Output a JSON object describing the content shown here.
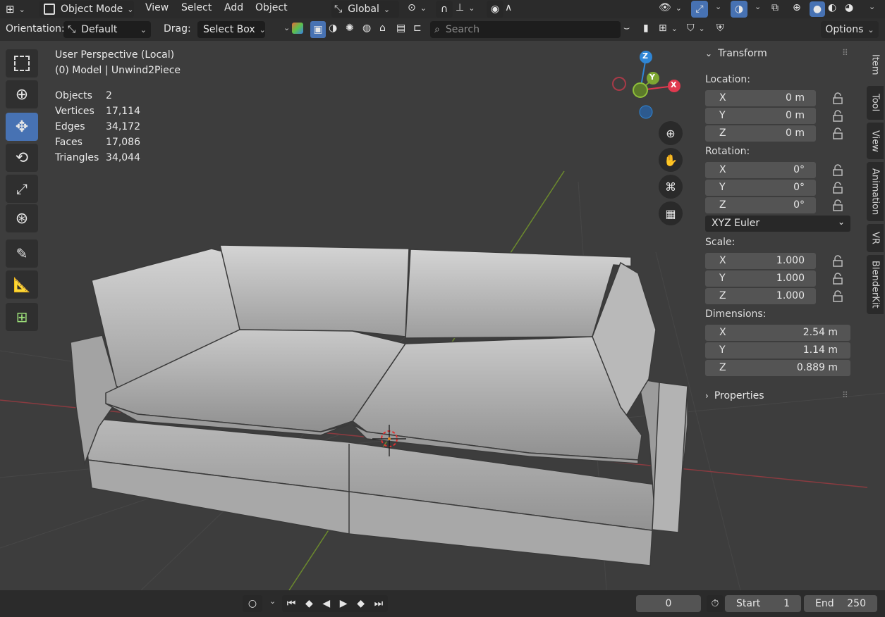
{
  "header": {
    "mode": "Object Mode",
    "menus": [
      "View",
      "Select",
      "Add",
      "Object"
    ],
    "transform_orientation": "Global"
  },
  "tool_settings": {
    "orientation_label": "Orientation:",
    "orientation_value": "Default",
    "drag_label": "Drag:",
    "drag_value": "Select Box",
    "search_placeholder": "Search",
    "options_label": "Options"
  },
  "viewport": {
    "view_name": "User Perspective (Local)",
    "object_info": "(0) Model | Unwind2Piece",
    "stats": [
      {
        "label": "Objects",
        "value": "2"
      },
      {
        "label": "Vertices",
        "value": "17,114"
      },
      {
        "label": "Edges",
        "value": "34,172"
      },
      {
        "label": "Faces",
        "value": "17,086"
      },
      {
        "label": "Triangles",
        "value": "34,044"
      }
    ],
    "gizmo": {
      "x": "X",
      "y": "Y",
      "z": "Z"
    }
  },
  "n_panel": {
    "transform_title": "Transform",
    "location_label": "Location:",
    "location": [
      {
        "axis": "X",
        "value": "0 m"
      },
      {
        "axis": "Y",
        "value": "0 m"
      },
      {
        "axis": "Z",
        "value": "0 m"
      }
    ],
    "rotation_label": "Rotation:",
    "rotation": [
      {
        "axis": "X",
        "value": "0°"
      },
      {
        "axis": "Y",
        "value": "0°"
      },
      {
        "axis": "Z",
        "value": "0°"
      }
    ],
    "rotation_mode": "XYZ Euler",
    "scale_label": "Scale:",
    "scale": [
      {
        "axis": "X",
        "value": "1.000"
      },
      {
        "axis": "Y",
        "value": "1.000"
      },
      {
        "axis": "Z",
        "value": "1.000"
      }
    ],
    "dimensions_label": "Dimensions:",
    "dimensions": [
      {
        "axis": "X",
        "value": "2.54 m"
      },
      {
        "axis": "Y",
        "value": "1.14 m"
      },
      {
        "axis": "Z",
        "value": "0.889 m"
      }
    ],
    "properties_title": "Properties"
  },
  "side_tabs": [
    "Item",
    "Tool",
    "View",
    "Animation",
    "VR",
    "BlenderKit"
  ],
  "timeline": {
    "current_frame": "0",
    "start_label": "Start",
    "start_value": "1",
    "end_label": "End",
    "end_value": "250"
  },
  "colors": {
    "accent": "#4772b3",
    "axis_x": "#e0394f",
    "axis_y": "#7da632",
    "axis_z": "#2f86d6",
    "viewport_bg": "#3d3d3d"
  }
}
